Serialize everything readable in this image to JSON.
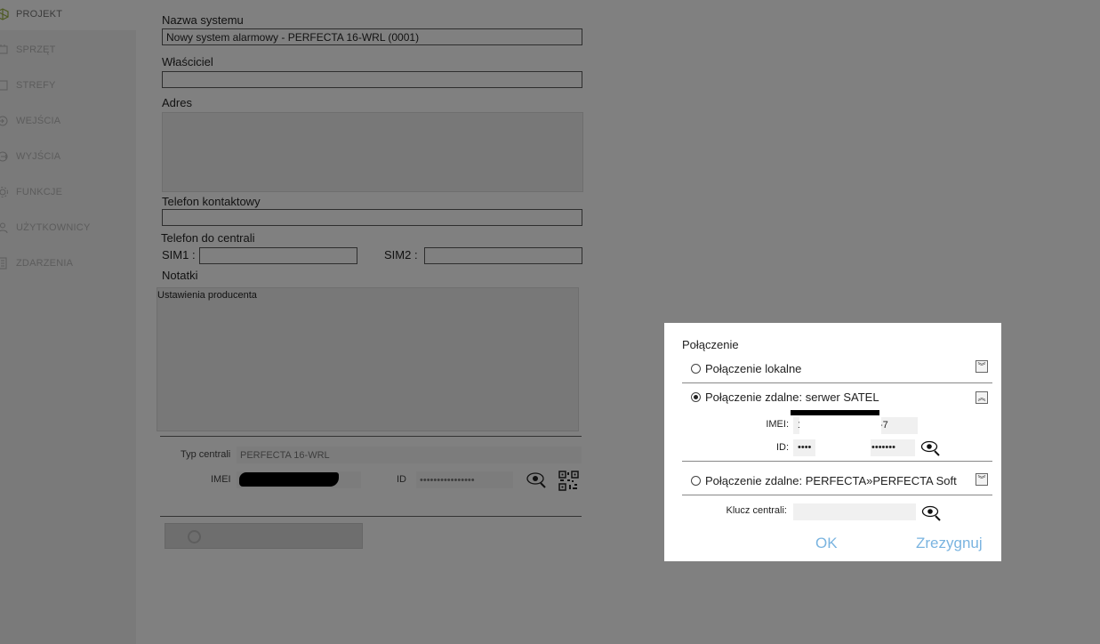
{
  "sidebar": {
    "items": [
      {
        "label": "PROJEKT",
        "icon": "cube-icon"
      },
      {
        "label": "SPRZĘT",
        "icon": "hardware-icon"
      },
      {
        "label": "STREFY",
        "icon": "zones-icon"
      },
      {
        "label": "WEJŚCIA",
        "icon": "inputs-icon"
      },
      {
        "label": "WYJŚCIA",
        "icon": "outputs-icon"
      },
      {
        "label": "FUNKCJE",
        "icon": "gear-icon"
      },
      {
        "label": "UŻYTKOWNICY",
        "icon": "user-icon"
      },
      {
        "label": "ZDARZENIA",
        "icon": "events-icon"
      }
    ]
  },
  "form": {
    "system_name_label": "Nazwa systemu",
    "system_name_value": "Nowy system alarmowy - PERFECTA 16-WRL  (0001)",
    "owner_label": "Właściciel",
    "address_label": "Adres",
    "contact_phone_label": "Telefon kontaktowy",
    "panel_phone_label": "Telefon do centrali",
    "sim1_label": "SIM1 :",
    "sim2_label": "SIM2 :",
    "notes_label": "Notatki",
    "notes_value": "Ustawienia producenta",
    "panel_type_label": "Typ centrali",
    "panel_type_value": "PERFECTA 16-WRL",
    "imei_label": "IMEI",
    "id_label": "ID",
    "id_value": "••••••••••••••••"
  },
  "dialog": {
    "title": "Połączenie",
    "options": [
      {
        "label": "Połączenie lokalne",
        "checked": false,
        "chevron": "expand"
      },
      {
        "label": "Połączenie zdalne: serwer SATEL",
        "checked": true,
        "chevron": "collapse"
      },
      {
        "label": "Połączenie zdalne: PERFECTA»PERFECTA Soft",
        "checked": false,
        "chevron": "expand"
      }
    ],
    "imei_label": "IMEI:",
    "imei_value_start": "1",
    "imei_value_end": "-7",
    "id_label": "ID:",
    "id_value_start": "••••",
    "id_value_end": "•••••••",
    "panel_key_label": "Klucz centrali:",
    "ok_label": "OK",
    "cancel_label": "Zrezygnuj"
  },
  "colors": {
    "accent": "#7ab4e0",
    "overlay_bg": "#808080"
  }
}
